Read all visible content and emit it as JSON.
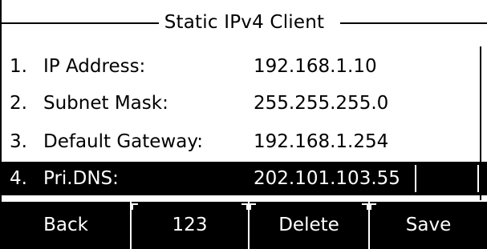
{
  "screen": {
    "title": "Static IPv4 Client"
  },
  "fields": [
    {
      "number": "1.",
      "label": "IP Address:",
      "value": "192.168.1.10"
    },
    {
      "number": "2.",
      "label": "Subnet Mask:",
      "value": "255.255.255.0"
    },
    {
      "number": "3.",
      "label": "Default Gateway:",
      "value": "192.168.1.254"
    },
    {
      "number": "4.",
      "label": "Pri.DNS:",
      "value": "202.101.103.55",
      "selected": true
    }
  ],
  "softkeys": {
    "back": "Back",
    "input_mode": "123",
    "delete": "Delete",
    "save": "Save"
  },
  "colors": {
    "background": "#ffffff",
    "foreground": "#000000",
    "selected_background": "#000000",
    "selected_text": "#ffffff"
  }
}
